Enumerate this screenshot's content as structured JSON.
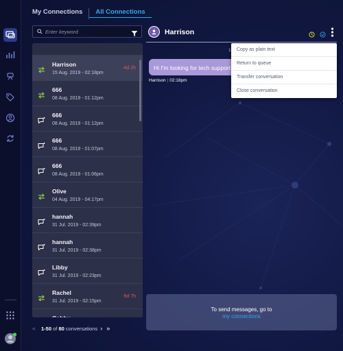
{
  "tabs": {
    "my": "My Connections",
    "all": "All Connections"
  },
  "search": {
    "placeholder": "Enter keyword"
  },
  "conversations": [
    {
      "name": "Harrison",
      "date": "15 Aug. 2019 - 02:18pm",
      "wait": "-4d 2h",
      "icon": "transfer-icon",
      "selected": true
    },
    {
      "name": "666",
      "date": "08 Aug. 2019 - 01:12pm",
      "wait": "",
      "icon": "transfer-icon"
    },
    {
      "name": "666",
      "date": "08 Aug. 2019 - 01:12pm",
      "wait": "",
      "icon": "chat-icon"
    },
    {
      "name": "666",
      "date": "08 Aug. 2019 - 01:07pm",
      "wait": "",
      "icon": "chat-icon"
    },
    {
      "name": "666",
      "date": "08 Aug. 2019 - 01:06pm",
      "wait": "",
      "icon": "chat-icon"
    },
    {
      "name": "Olive",
      "date": "04 Aug. 2019 - 04:17pm",
      "wait": "",
      "icon": "transfer-icon"
    },
    {
      "name": "hannah",
      "date": "31 Jul. 2019 - 02:39pm",
      "wait": "",
      "icon": "chat-icon"
    },
    {
      "name": "hannah",
      "date": "31 Jul. 2019 - 02:38pm",
      "wait": "",
      "icon": "chat-icon"
    },
    {
      "name": "Libby",
      "date": "31 Jul. 2019 - 02:23pm",
      "wait": "",
      "icon": "chat-icon"
    },
    {
      "name": "Rachel",
      "date": "31 Jul. 2019 - 02:15pm",
      "wait": "-5d 7h",
      "icon": "transfer-icon"
    },
    {
      "name": "Gabby",
      "date": "",
      "wait": "",
      "icon": "transfer-icon"
    }
  ],
  "pager": {
    "range": "1-50",
    "of": "of",
    "total": "80",
    "suffix": "conversations"
  },
  "chat": {
    "name": "Harrison",
    "date_separator": "1",
    "message": "Hi I'm looking for tech support",
    "sender": "Harrison",
    "time": "02:18pm"
  },
  "menu": [
    "Copy as plain text",
    "Return to queue",
    "Transfer conversation",
    "Close conversation"
  ],
  "composer": {
    "text": "To send messages, go to",
    "link": "my connections"
  },
  "colors": {
    "accent": "#32a8e8",
    "wait": "#e05858",
    "transfer_icon": "#8bc34a",
    "status_dot": "#3ddc4a"
  }
}
